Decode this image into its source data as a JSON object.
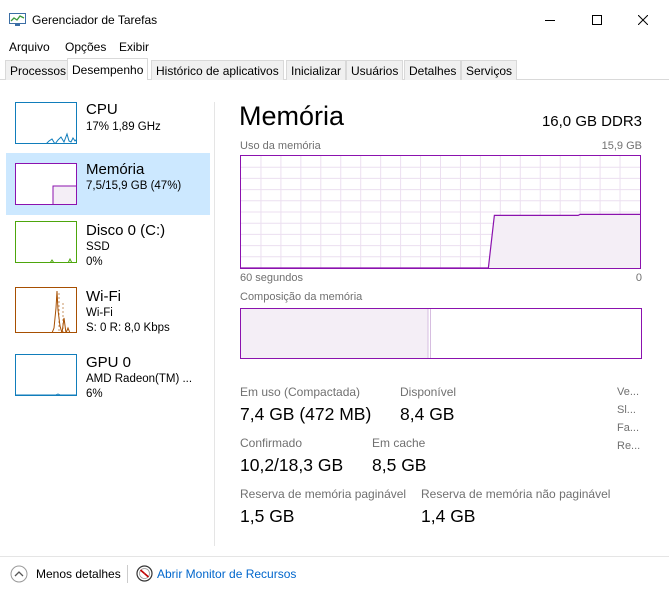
{
  "window": {
    "title": "Gerenciador de Tarefas"
  },
  "menu": [
    "Arquivo",
    "Opções",
    "Exibir"
  ],
  "tabs": [
    "Processos",
    "Desempenho",
    "Histórico de aplicativos",
    "Inicializar",
    "Usuários",
    "Detalhes",
    "Serviços"
  ],
  "active_tab": "Desempenho",
  "resources": [
    {
      "name": "CPU",
      "sub1": "17%  1,89 GHz",
      "sub2": "",
      "color": "#117dbb"
    },
    {
      "name": "Memória",
      "sub1": "7,5/15,9 GB (47%)",
      "sub2": "",
      "color": "#8b12ae"
    },
    {
      "name": "Disco 0 (C:)",
      "sub1": "SSD",
      "sub2": "0%",
      "color": "#4da60c"
    },
    {
      "name": "Wi-Fi",
      "sub1": "Wi-Fi",
      "sub2": "S: 0  R: 8,0 Kbps",
      "color": "#a74f01"
    },
    {
      "name": "GPU 0",
      "sub1": "AMD Radeon(TM) ...",
      "sub2": "6%",
      "color": "#117dbb"
    }
  ],
  "memory": {
    "title": "Memória",
    "spec": "16,0 GB DDR3",
    "usage_label": "Uso da memória",
    "usage_max": "15,9 GB",
    "time_left": "60 segundos",
    "time_right": "0",
    "composition_label": "Composição da memória",
    "usage_fraction_start": 0.0,
    "usage_fraction_end": 0.47,
    "in_use_fraction": 0.47
  },
  "stats": {
    "in_use_label": "Em uso (Compactada)",
    "in_use_value": "7,4 GB (472 MB)",
    "available_label": "Disponível",
    "available_value": "8,4 GB",
    "committed_label": "Confirmado",
    "committed_value": "10,2/18,3 GB",
    "cached_label": "Em cache",
    "cached_value": "8,5 GB",
    "paged_label": "Reserva de memória paginável",
    "paged_value": "1,5 GB",
    "nonpaged_label": "Reserva de memória não paginável",
    "nonpaged_value": "1,4 GB",
    "right_column": [
      "Ve...",
      "Sl...",
      "Fa...",
      "Re..."
    ]
  },
  "footer": {
    "fewer_details": "Menos detalhes",
    "open_monitor": "Abrir Monitor de Recursos"
  },
  "icons": {
    "app": "task-manager-icon",
    "minimize": "minimize-icon",
    "maximize": "maximize-icon",
    "close": "close-icon",
    "collapse": "chevron-up-icon",
    "monitor": "resource-monitor-icon"
  },
  "colors": {
    "memory_accent": "#8b12ae",
    "selected_bg": "#cce8ff",
    "link": "#0066cc"
  }
}
